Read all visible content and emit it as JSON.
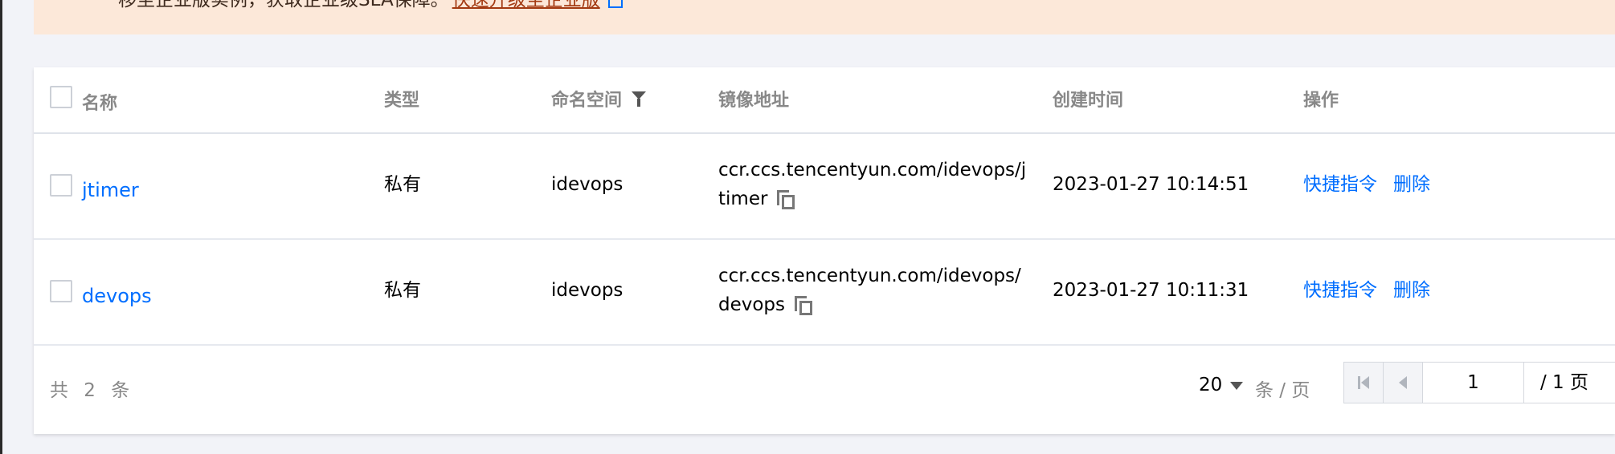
{
  "banner": {
    "text": "移至企业版实例，获取企业级SLA保障。",
    "link": "快速升级至企业版"
  },
  "table": {
    "headers": {
      "name": "名称",
      "type": "类型",
      "namespace": "命名空间",
      "address": "镜像地址",
      "created": "创建时间",
      "actions": "操作"
    },
    "rows": [
      {
        "name": "jtimer",
        "type": "私有",
        "namespace": "idevops",
        "address": "ccr.ccs.tencentyun.com/idevops/jtimer",
        "created": "2023-01-27 10:14:51",
        "action_shortcut": "快捷指令",
        "action_delete": "删除"
      },
      {
        "name": "devops",
        "type": "私有",
        "namespace": "idevops",
        "address": "ccr.ccs.tencentyun.com/idevops/devops",
        "created": "2023-01-27 10:11:31",
        "action_shortcut": "快捷指令",
        "action_delete": "删除"
      }
    ]
  },
  "pagination": {
    "total": "共 2 条",
    "page_size": "20",
    "per_page_label": "条 / 页",
    "current_page": "1",
    "total_pages": "/ 1 页"
  }
}
